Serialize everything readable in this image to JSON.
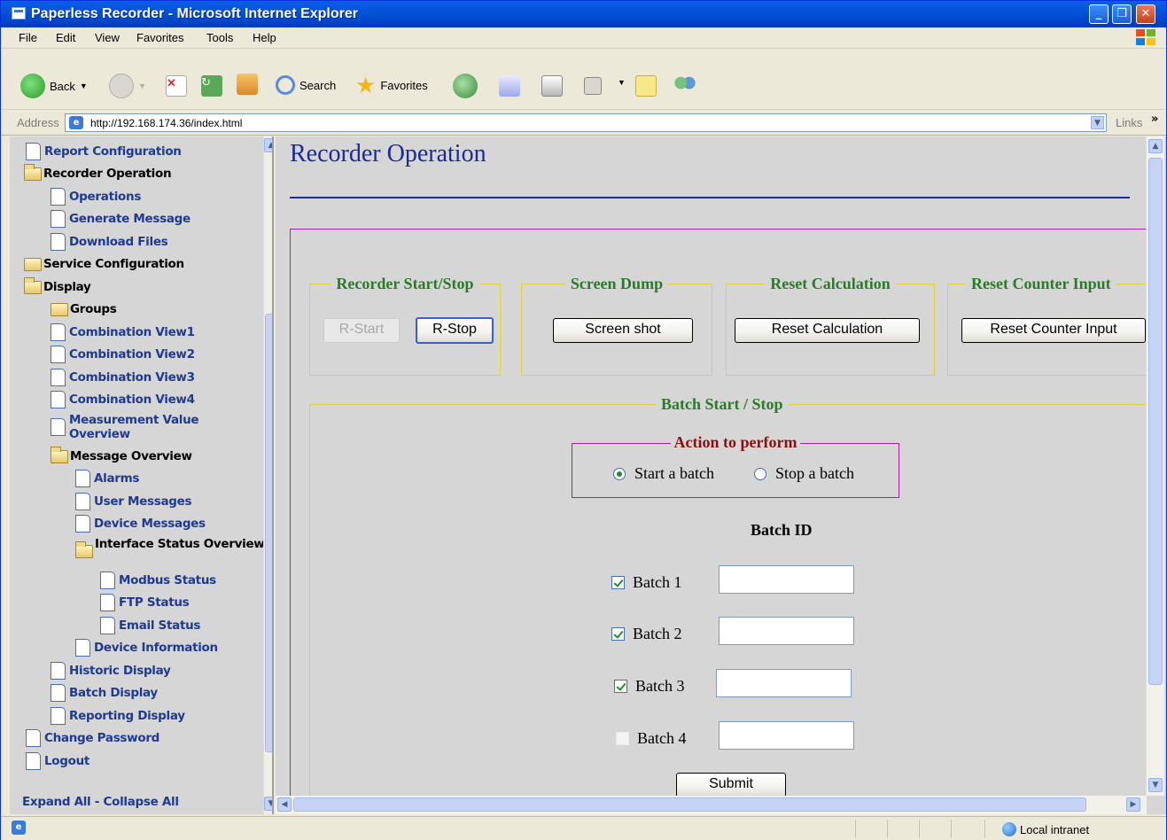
{
  "window": {
    "title": "Paperless Recorder - Microsoft Internet Explorer"
  },
  "menu": [
    "File",
    "Edit",
    "View",
    "Favorites",
    "Tools",
    "Help"
  ],
  "toolbar": {
    "back": "Back",
    "search": "Search",
    "favorites": "Favorites"
  },
  "address": {
    "label": "Address",
    "url": "http://192.168.174.36/index.html",
    "links": "Links",
    "chevron": "»"
  },
  "nav": {
    "items": [
      {
        "label": "Report Configuration"
      },
      {
        "label": "Recorder Operation"
      },
      {
        "label": "Operations"
      },
      {
        "label": "Generate Message"
      },
      {
        "label": "Download Files"
      },
      {
        "label": "Service Configuration"
      },
      {
        "label": "Display"
      },
      {
        "label": "Groups"
      },
      {
        "label": "Combination View1"
      },
      {
        "label": "Combination View2"
      },
      {
        "label": "Combination View3"
      },
      {
        "label": "Combination View4"
      },
      {
        "label": "Measurement Value Overview"
      },
      {
        "label": "Message Overview"
      },
      {
        "label": "Alarms"
      },
      {
        "label": "User Messages"
      },
      {
        "label": "Device Messages"
      },
      {
        "label": "Interface Status Overview"
      },
      {
        "label": "Modbus Status"
      },
      {
        "label": "FTP Status"
      },
      {
        "label": "Email Status"
      },
      {
        "label": "Device Information"
      },
      {
        "label": "Historic Display"
      },
      {
        "label": "Batch Display"
      },
      {
        "label": "Reporting Display"
      },
      {
        "label": "Change Password"
      },
      {
        "label": "Logout"
      }
    ],
    "expand_collapse": "Expand All - Collapse All"
  },
  "page": {
    "title": "Recorder Operation",
    "recorder": {
      "legend": "Recorder Start/Stop",
      "start": "R-Start",
      "stop": "R-Stop"
    },
    "screen_dump": {
      "legend": "Screen Dump",
      "button": "Screen shot"
    },
    "reset_calc": {
      "legend": "Reset Calculation",
      "button": "Reset Calculation"
    },
    "reset_counter": {
      "legend": "Reset Counter Input",
      "button": "Reset Counter Input"
    },
    "batch": {
      "legend": "Batch Start / Stop",
      "action_legend": "Action to perform",
      "start_label": "Start a batch",
      "stop_label": "Stop a batch",
      "selected": "start",
      "batch_id_label": "Batch ID",
      "rows": [
        {
          "label": "Batch 1",
          "checked": true,
          "value": ""
        },
        {
          "label": "Batch 2",
          "checked": true,
          "value": ""
        },
        {
          "label": "Batch 3",
          "checked": true,
          "value": ""
        },
        {
          "label": "Batch 4",
          "checked": false,
          "value": ""
        }
      ],
      "submit": "Submit"
    }
  },
  "status": {
    "zone": "Local intranet"
  }
}
